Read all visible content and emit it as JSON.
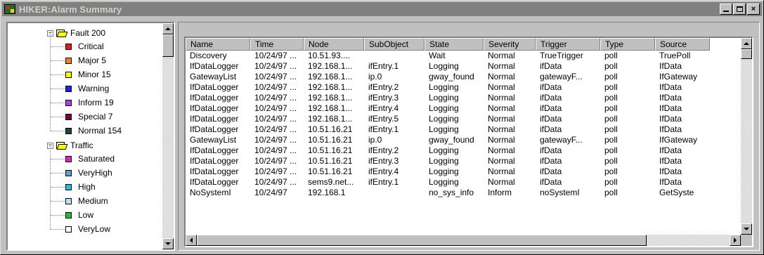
{
  "window": {
    "title": "HIKER:Alarm Summary",
    "controls": {
      "minimize": "_",
      "maximize": "□",
      "close": "×"
    }
  },
  "tree": {
    "groups": [
      {
        "label": "Fault 200",
        "expander": "−",
        "items": [
          {
            "label": "Critical",
            "color": "#e81818"
          },
          {
            "label": "Major 5",
            "color": "#f08020"
          },
          {
            "label": "Minor 15",
            "color": "#ffff00"
          },
          {
            "label": "Warning",
            "color": "#2020e8"
          },
          {
            "label": "Inform 19",
            "color": "#b040e0"
          },
          {
            "label": "Special 7",
            "color": "#800040"
          },
          {
            "label": "Normal 154",
            "color": "#1a4a3a"
          }
        ]
      },
      {
        "label": "Traffic",
        "expander": "−",
        "items": [
          {
            "label": "Saturated",
            "color": "#e020c0"
          },
          {
            "label": "VeryHigh",
            "color": "#60a0d0"
          },
          {
            "label": "High",
            "color": "#20c0e0"
          },
          {
            "label": "Medium",
            "color": "#b0e8f0"
          },
          {
            "label": "Low",
            "color": "#20c020"
          },
          {
            "label": "VeryLow",
            "color": "#ffffff"
          }
        ]
      }
    ]
  },
  "table": {
    "columns": [
      "Name",
      "Time",
      "Node",
      "SubObject",
      "State",
      "Severity",
      "Trigger",
      "Type",
      "Source"
    ],
    "rows": [
      [
        "Discovery",
        "10/24/97 ...",
        "10.51.93....",
        "",
        "Wait",
        "Normal",
        "TrueTrigger",
        "poll",
        "TruePoll"
      ],
      [
        "IfDataLogger",
        "10/24/97 ...",
        "192.168.1...",
        "ifEntry.1",
        "Logging",
        "Normal",
        "ifData",
        "poll",
        "IfData"
      ],
      [
        "GatewayList",
        "10/24/97 ...",
        "192.168.1...",
        "ip.0",
        "gway_found",
        "Normal",
        "gatewayF...",
        "poll",
        "IfGateway"
      ],
      [
        "IfDataLogger",
        "10/24/97 ...",
        "192.168.1...",
        "ifEntry.2",
        "Logging",
        "Normal",
        "ifData",
        "poll",
        "IfData"
      ],
      [
        "IfDataLogger",
        "10/24/97 ...",
        "192.168.1...",
        "ifEntry.3",
        "Logging",
        "Normal",
        "ifData",
        "poll",
        "IfData"
      ],
      [
        "IfDataLogger",
        "10/24/97 ...",
        "192.168.1...",
        "ifEntry.4",
        "Logging",
        "Normal",
        "ifData",
        "poll",
        "IfData"
      ],
      [
        "IfDataLogger",
        "10/24/97 ...",
        "192.168.1...",
        "ifEntry.5",
        "Logging",
        "Normal",
        "ifData",
        "poll",
        "IfData"
      ],
      [
        "IfDataLogger",
        "10/24/97 ...",
        "10.51.16.21",
        "ifEntry.1",
        "Logging",
        "Normal",
        "ifData",
        "poll",
        "IfData"
      ],
      [
        "GatewayList",
        "10/24/97 ...",
        "10.51.16.21",
        "ip.0",
        "gway_found",
        "Normal",
        "gatewayF...",
        "poll",
        "IfGateway"
      ],
      [
        "IfDataLogger",
        "10/24/97 ...",
        "10.51.16.21",
        "ifEntry.2",
        "Logging",
        "Normal",
        "ifData",
        "poll",
        "IfData"
      ],
      [
        "IfDataLogger",
        "10/24/97 ...",
        "10.51.16.21",
        "ifEntry.3",
        "Logging",
        "Normal",
        "ifData",
        "poll",
        "IfData"
      ],
      [
        "IfDataLogger",
        "10/24/97 ...",
        "10.51.16.21",
        "ifEntry.4",
        "Logging",
        "Normal",
        "ifData",
        "poll",
        "IfData"
      ],
      [
        "IfDataLogger",
        "10/24/97 ...",
        "sems9.net...",
        "ifEntry.1",
        "Logging",
        "Normal",
        "ifData",
        "poll",
        "IfData"
      ],
      [
        "NoSystemI",
        "10/24/97",
        "192.168.1",
        "",
        "no_sys_info",
        "Inform",
        "noSystemI",
        "poll",
        "GetSyste"
      ]
    ]
  }
}
